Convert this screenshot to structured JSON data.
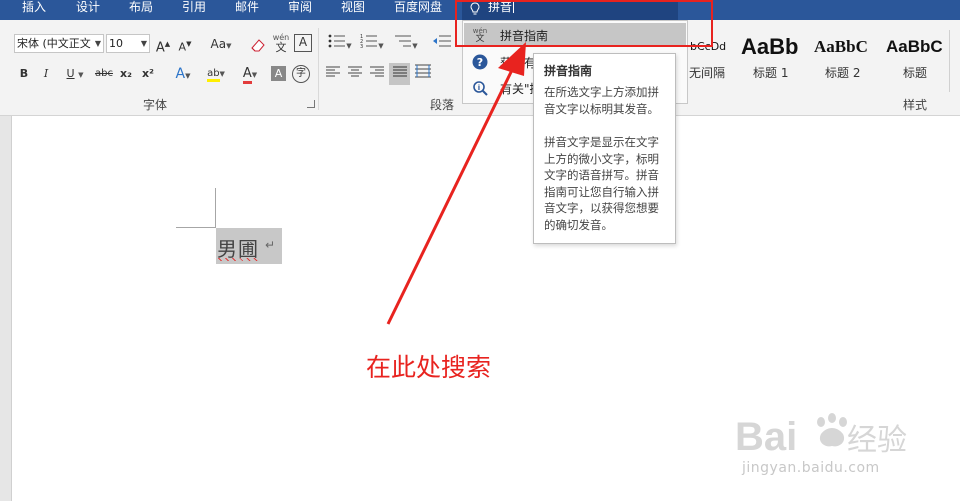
{
  "ribbon_tabs": [
    "插入",
    "设计",
    "布局",
    "引用",
    "邮件",
    "审阅",
    "视图",
    "百度网盘"
  ],
  "tell_me": {
    "query": "拼音"
  },
  "font_group": {
    "font_name": "宋体 (中文正文",
    "font_size": "10",
    "label": "字体",
    "change_case": "Aa",
    "phonetic_glyph_top": "wén",
    "phonetic_glyph_bottom": "文",
    "border_glyph": "A",
    "bold": "B",
    "italic": "I",
    "underline": "U",
    "strike": "abc",
    "subscript": "x₂",
    "superscript": "x²",
    "effects": "A",
    "highlight": "ab",
    "font_color": "A",
    "shading": "A",
    "enclose": "字"
  },
  "paragraph_group": {
    "label": "段落"
  },
  "styles_group": {
    "label": "样式",
    "items": [
      {
        "sample": "bCcDd",
        "name": "无间隔"
      },
      {
        "sample": "AaBb",
        "name": "标题 1"
      },
      {
        "sample": "AaBbC",
        "name": "标题 2"
      },
      {
        "sample": "AaBbC",
        "name": "标题"
      }
    ]
  },
  "dropdown": {
    "items": [
      {
        "label": "拼音指南",
        "icon": "phonetic-guide-icon"
      },
      {
        "label": "获取有",
        "icon": "help-icon"
      },
      {
        "label": "有关\"拼",
        "icon": "smart-lookup-icon"
      }
    ]
  },
  "tooltip": {
    "title": "拼音指南",
    "p1": "在所选文字上方添加拼音文字以标明其发音。",
    "p2": "拼音文字是显示在文字上方的微小文字，标明文字的语音拼写。拼音指南可让您自行输入拼音文字，以获得您想要的确切发音。"
  },
  "document": {
    "text": "男圃",
    "paragraph_mark": "↵"
  },
  "annotation": {
    "text": "在此处搜索",
    "color": "#e8231f"
  },
  "watermark": {
    "brand": "Bai du 经验",
    "url": "jingyan.baidu.com"
  },
  "colors": {
    "ribbon_blue": "#2b579a",
    "highlight_yellow": "#ffef00",
    "font_red": "#e23b3b"
  }
}
